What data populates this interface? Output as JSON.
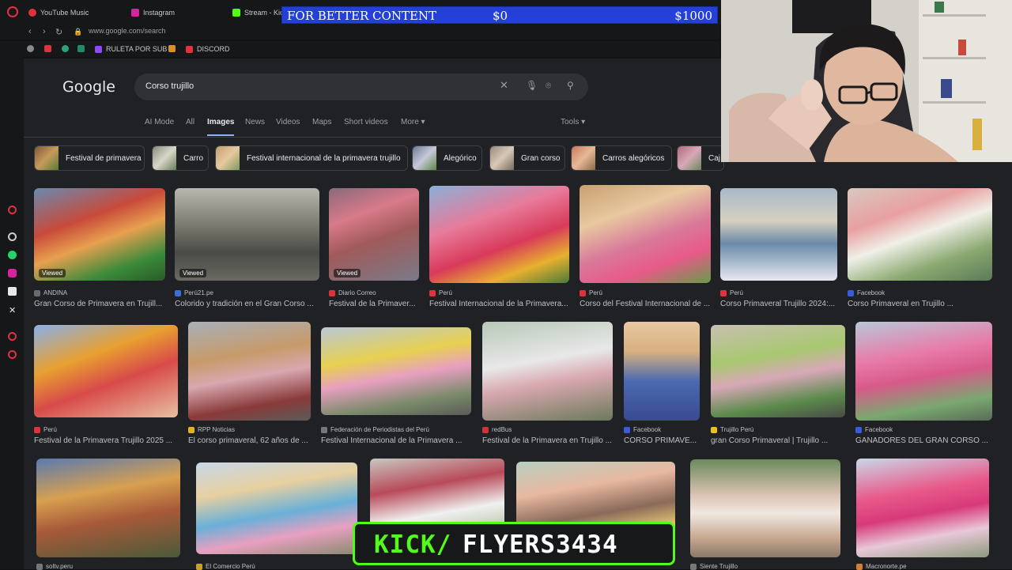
{
  "browser": {
    "tabs": [
      {
        "label": "YouTube Music",
        "color": "#e0323c"
      },
      {
        "label": "Instagram",
        "color": "#d6249f"
      },
      {
        "label": "Stream - Kick",
        "color": "#53fc18"
      }
    ],
    "url": "www.google.com/search",
    "bookmarks": [
      {
        "label": "RULETA POR SUB",
        "color": "#9146ff"
      },
      {
        "label": "DISCORD",
        "color": "#e0323c"
      }
    ]
  },
  "google": {
    "logo": "Google",
    "query": "Corso trujillo",
    "tabs": [
      "AI Mode",
      "All",
      "Images",
      "News",
      "Videos",
      "Maps",
      "Short videos",
      "More ▾"
    ],
    "active_tab": "Images",
    "tools_label": "Tools ▾",
    "chips": [
      "Festival de primavera",
      "Carro",
      "Festival internacional de la primavera trujillo",
      "Alegórico",
      "Gran corso",
      "Carros alegóricos",
      "Caj"
    ],
    "results": [
      {
        "source": "ANDINA",
        "title": "Gran Corso de Primavera en Trujill...",
        "viewed": "Viewed",
        "fav": "#6a6a6a"
      },
      {
        "source": "Perú21.pe",
        "title": "Colorido y tradición en el Gran Corso ...",
        "viewed": "Viewed",
        "fav": "#3a6fd8"
      },
      {
        "source": "Diario Correo",
        "title": "Festival de la Primaver...",
        "viewed": "Viewed",
        "fav": "#e0323c"
      },
      {
        "source": "Perú",
        "title": "Festival Internacional de la Primavera...",
        "viewed": "",
        "fav": "#e0323c"
      },
      {
        "source": "Perú",
        "title": "Corso del Festival Internacional de ...",
        "viewed": "",
        "fav": "#e0323c"
      },
      {
        "source": "Perú",
        "title": "Corso Primaveral Trujillo 2024:...",
        "viewed": "",
        "fav": "#e0323c"
      },
      {
        "source": "Facebook",
        "title": "Corso Primaveral en Trujillo ...",
        "viewed": "",
        "fav": "#3b5bdb"
      },
      {
        "source": "Perú",
        "title": "Festival de la Primavera Trujillo 2025 ...",
        "viewed": "",
        "fav": "#e0323c"
      },
      {
        "source": "RPP Noticias",
        "title": "El corso primaveral, 62 años de ...",
        "viewed": "",
        "fav": "#e8b020"
      },
      {
        "source": "Federación de Periodistas del Perú",
        "title": "Festival Internacional de la Primavera ...",
        "viewed": "",
        "fav": "#777777"
      },
      {
        "source": "redBus",
        "title": "Festival de la Primavera en Trujillo ...",
        "viewed": "",
        "fav": "#d0323c"
      },
      {
        "source": "Facebook",
        "title": "CORSO PRIMAVE...",
        "viewed": "",
        "fav": "#3b5bdb"
      },
      {
        "source": "Trujillo Perú",
        "title": "gran Corso Primaveral | Trujillo ...",
        "viewed": "",
        "fav": "#e8c020"
      },
      {
        "source": "Facebook",
        "title": "GANADORES DEL GRAN CORSO ...",
        "viewed": "",
        "fav": "#3b5bdb"
      },
      {
        "source": "soltv.peru",
        "title": "",
        "viewed": "",
        "fav": "#777777"
      },
      {
        "source": "El Comercio Perú",
        "title": "",
        "viewed": "",
        "fav": "#c8a030"
      },
      {
        "source": "",
        "title": "",
        "viewed": "",
        "fav": "#777777"
      },
      {
        "source": "",
        "title": "",
        "viewed": "",
        "fav": "#777777"
      },
      {
        "source": "Siente Trujillo",
        "title": "",
        "viewed": "",
        "fav": "#777777"
      },
      {
        "source": "Macronorte.pe",
        "title": "",
        "viewed": "",
        "fav": "#d08030"
      }
    ]
  },
  "overlay": {
    "goal_text": "FOR BETTER CONTENT",
    "goal_current": "$0",
    "goal_target": "$1000",
    "kick_prefix": "KICK/",
    "kick_channel": "FLYERS3434"
  }
}
